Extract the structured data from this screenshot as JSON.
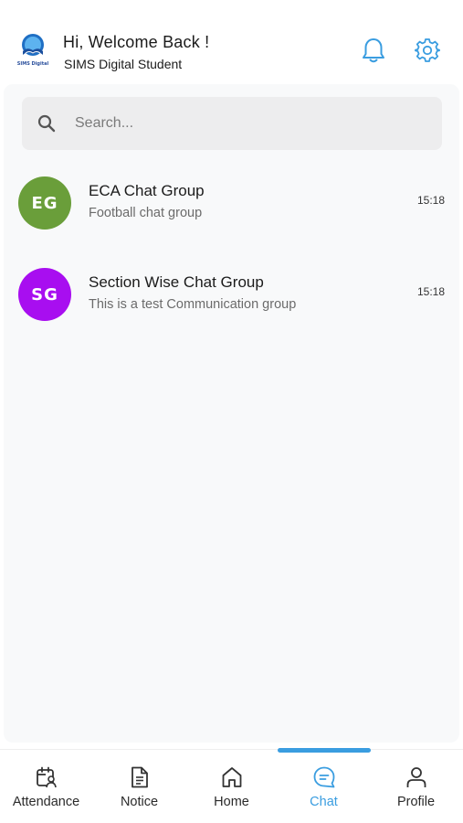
{
  "header": {
    "logo_text": "SIMS Digital",
    "greeting": "Hi, Welcome Back !",
    "subtitle": "SIMS Digital Student",
    "icons": [
      "bell-icon",
      "gear-icon"
    ],
    "accent_color": "#3a9de0"
  },
  "search": {
    "placeholder": "Search..."
  },
  "chats": [
    {
      "initials": "EG",
      "name": "ECA Chat Group",
      "preview": "Football chat group",
      "time": "15:18",
      "avatar_color": "#6a9e3a"
    },
    {
      "initials": "SG",
      "name": "Section Wise Chat Group",
      "preview": "This is a test Communication group",
      "time": "15:18",
      "avatar_color": "#a80ef0"
    }
  ],
  "nav": {
    "items": [
      {
        "label": "Attendance",
        "icon": "calendar-person-icon"
      },
      {
        "label": "Notice",
        "icon": "document-icon"
      },
      {
        "label": "Home",
        "icon": "home-icon"
      },
      {
        "label": "Chat",
        "icon": "chat-icon"
      },
      {
        "label": "Profile",
        "icon": "person-icon"
      }
    ],
    "active": "Chat",
    "active_color": "#3a9de0"
  }
}
